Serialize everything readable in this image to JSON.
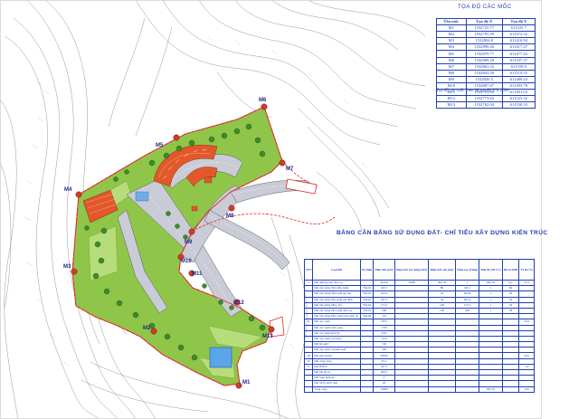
{
  "coord_table": {
    "title": "TỌA ĐỘ CÁC MỐC",
    "headers": [
      "Tên mốc",
      "Tọa độ X",
      "Tọa độ Y"
    ],
    "rows": [
      [
        "M1",
        "1532725.77",
        "611525.7"
      ],
      [
        "M2",
        "1532795.29",
        "611472.32"
      ],
      [
        "M3",
        "1532804.8",
        "611416.94"
      ],
      [
        "M4",
        "1532890.26",
        "611417.47"
      ],
      [
        "M5",
        "1532879.77",
        "611477.42"
      ],
      [
        "M6",
        "1532909.29",
        "611537.37"
      ],
      [
        "M7",
        "1532863.32",
        "611559.9"
      ],
      [
        "M8",
        "1532843.59",
        "611519.55"
      ],
      [
        "M9",
        "1532820.3",
        "611489.43"
      ],
      [
        "M10",
        "1532807.67",
        "611493.79"
      ],
      [
        "M11",
        "1532793.09",
        "611491.03"
      ],
      [
        "M12",
        "1532773.65",
        "611523.32"
      ],
      [
        "M13",
        "1532762.04",
        "611550.33"
      ]
    ],
    "note": "- Tọa độ các mốc theo hệ tọa độ VN:2000"
  },
  "balance_table": {
    "title": "BẢNG CÂN BẰNG SỬ DỤNG ĐẤT- CHỈ TIÊU XÂY DỰNG KIẾN TRÚC",
    "headers": [
      "STT",
      "Loại đất",
      "Ký hiệu",
      "Diện tích (m2)",
      "Diện tích xây dựng (m2)",
      "Diện tích sàn (m2)",
      "Tầng cao (Tầng)",
      "Mật độ XD (%)",
      "Hệ số SDĐ",
      "Tỷ lệ (%)"
    ],
    "rows": [
      [
        "I",
        "Đất thương mại dịch vụ",
        "",
        "4545.6",
        "59.86",
        "962.76",
        "1",
        "962.76",
        "0.2",
        "27.0"
      ],
      [
        "",
        "Đất xây dựng Nhà điều hành",
        "TM-01",
        "243.7",
        "",
        "80",
        "145.1",
        "1",
        "60",
        ""
      ],
      [
        "",
        "Đất xây dựng Nhà nghỉ tập thể",
        "TM-02",
        "412.4",
        "",
        "32",
        "96.64",
        "1",
        "38",
        ""
      ],
      [
        "",
        "Đất xây dựng Nhà nghỉ gia đình",
        "TM-03",
        "437.2",
        "",
        "34",
        "96.14",
        "1",
        "34",
        ""
      ],
      [
        "",
        "Đất xây dựng Nhà cafe",
        "TM-04",
        "172.2",
        "",
        "100",
        "172.2",
        "1",
        "34",
        ""
      ],
      [
        "",
        "Đất xây dựng Nhà nghỉ dịch vụ",
        "TM-05",
        "268",
        "",
        "100",
        "268",
        "1",
        "38",
        ""
      ],
      [
        "",
        "Đất xây dựng Nhà chòm nhỏ dịch vụ",
        "TM-06",
        "125",
        "",
        "",
        "",
        "",
        "",
        ""
      ],
      [
        "II",
        "Đất cây xanh",
        "",
        "5874",
        "",
        "",
        "",
        "",
        "",
        "34.9"
      ],
      [
        "",
        "Đất cây xanh cảnh quan",
        "",
        "1750",
        "",
        "",
        "",
        "",
        "",
        ""
      ],
      [
        "",
        "Đất cây xanh kết hợp",
        "",
        "2411",
        "",
        "",
        "",
        "",
        "",
        ""
      ],
      [
        "",
        "Đất cây xanh ven taluy",
        "",
        "1113",
        "",
        "",
        "",
        "",
        "",
        ""
      ],
      [
        "",
        "Đất hồ nước",
        "",
        "150",
        "",
        "",
        "",
        "",
        "",
        ""
      ],
      [
        "",
        "Đất cây xanh ven khe suối",
        "",
        "450",
        "",
        "",
        "",
        "",
        "",
        ""
      ],
      [
        "III",
        "Đất giao thông",
        "",
        "3360.6",
        "",
        "",
        "",
        "",
        "",
        "20.0"
      ],
      [
        "IV",
        "Đất công cộng",
        "",
        "65.4",
        "",
        "",
        "",
        "",
        "",
        ""
      ],
      [
        "V",
        "Đất HTKT",
        "",
        "237.5",
        "",
        "",
        "",
        "",
        "",
        "1.4"
      ],
      [
        "",
        "Đất bãi đỗ xe",
        "",
        "200.5",
        "",
        "",
        "",
        "",
        "",
        ""
      ],
      [
        "",
        "Đất trạm biến áp",
        "",
        "17",
        "",
        "",
        "",
        "",
        "",
        ""
      ],
      [
        "",
        "Đất xử lý nước thải",
        "",
        "20",
        "",
        "",
        "",
        "",
        "",
        ""
      ],
      [
        "",
        "Tổng cộng",
        "",
        "16808",
        "",
        "",
        "",
        "962.76",
        "",
        "100"
      ]
    ]
  },
  "markers": [
    "M1",
    "M2",
    "M3",
    "M4",
    "M5",
    "M6",
    "M7",
    "M8",
    "M9",
    "M10",
    "M11",
    "M12",
    "M13"
  ],
  "colors": {
    "boundary": "#e3262a",
    "site_green": "#8fc64a",
    "road": "#c8ccd6",
    "building": "#e2582a",
    "water": "#5aa6e8",
    "table_ink": "#1f3fb0",
    "contour": "#2e2e2e"
  }
}
